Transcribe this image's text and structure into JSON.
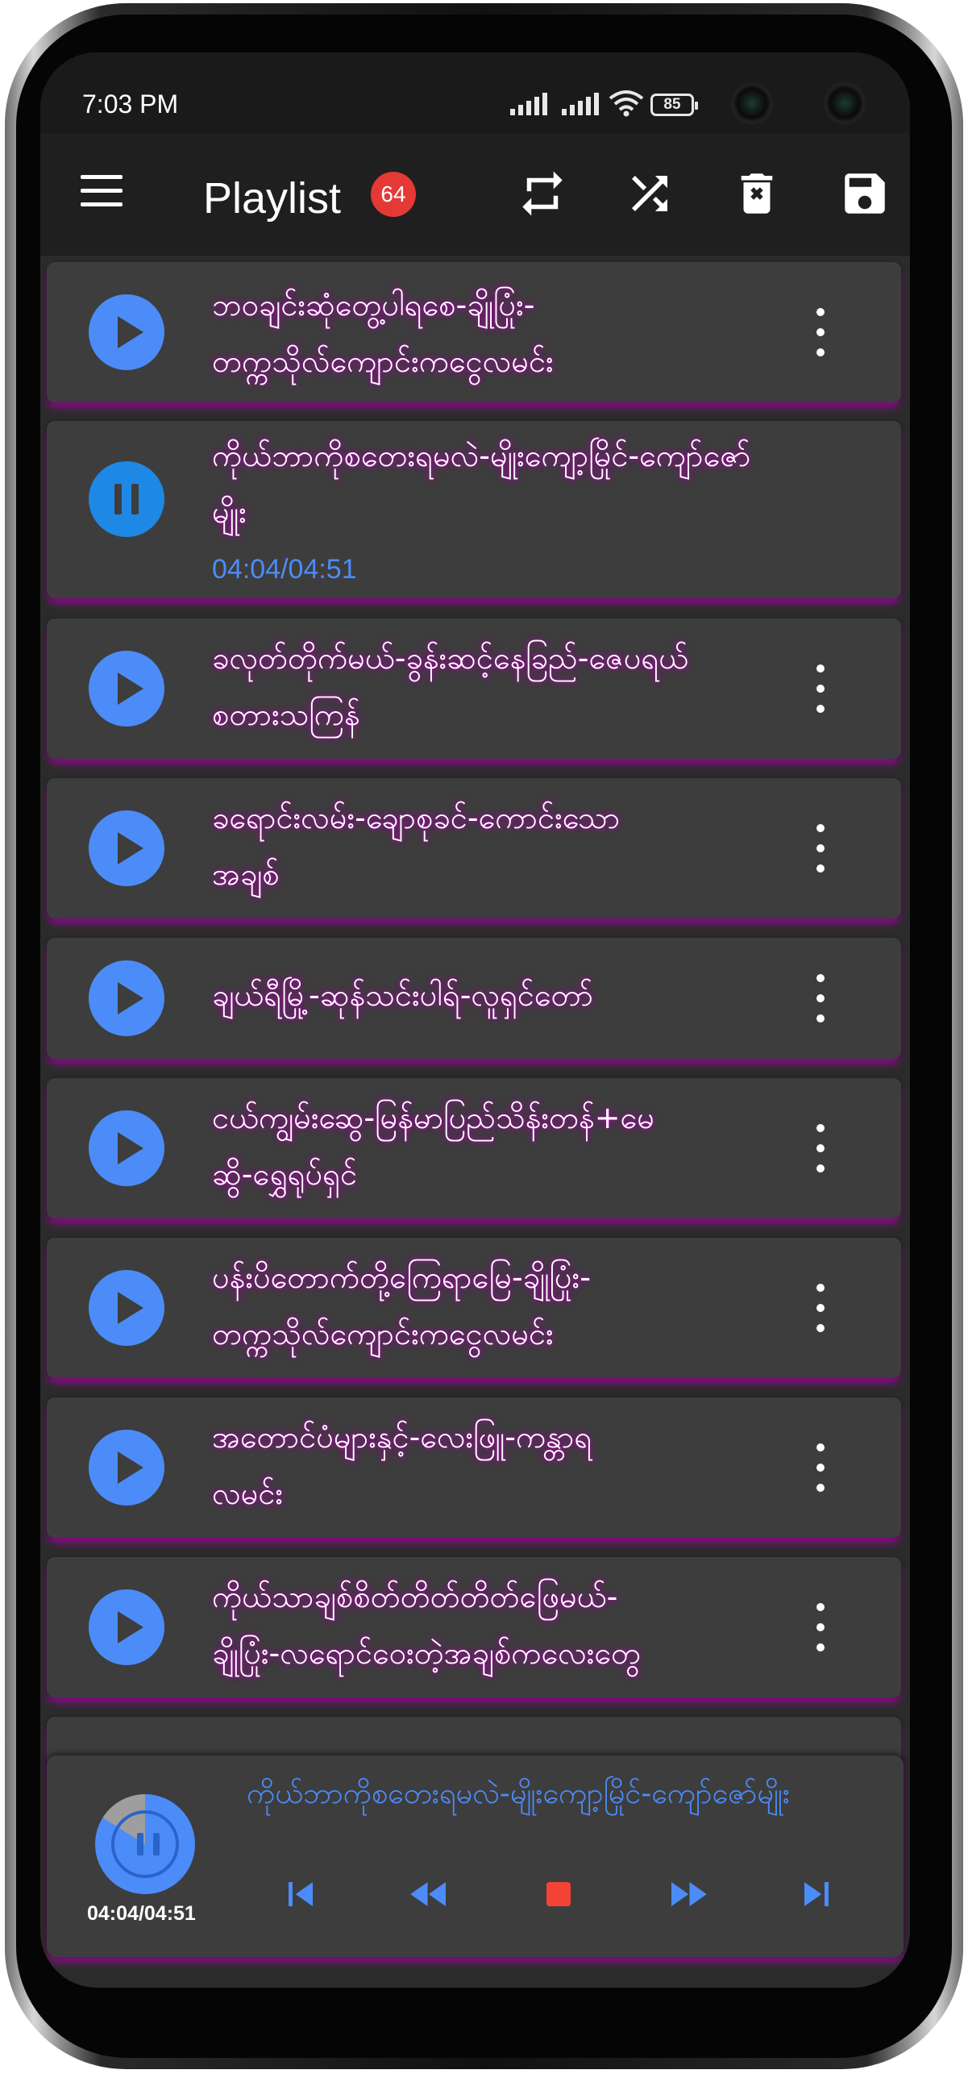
{
  "status_bar": {
    "time": "7:03 PM",
    "battery_level": "85"
  },
  "app_bar": {
    "title": "Playlist",
    "count_badge": "64",
    "icons": [
      "menu-icon",
      "repeat-icon",
      "shuffle-icon",
      "delete-icon",
      "save-icon"
    ]
  },
  "playlist": {
    "items": [
      {
        "line1": "ဘဝချင်းဆုံတွေ့ပါရစေ-ချိုပြုံး-",
        "line2": "တက္ကသိုလ်ကျောင်းကငွေလမင်း",
        "state": "play"
      },
      {
        "line1": "ကိုယ်ဘာကိုစတေးရမလဲ-မျိုးကျော့မြိုင်-ကျော်ဇော်",
        "line2": "မျိုး",
        "state": "pause",
        "progress": "04:04/04:51"
      },
      {
        "line1": "ခလုတ်တိုက်မယ်-ခွန်းဆင့်နေခြည်-ဇေပရယ်",
        "line2": "စတားသကြန်",
        "state": "play"
      },
      {
        "line1": "ခရောင်းလမ်း-ချောစုခင်-ကောင်းသော",
        "line2": "အချစ်",
        "state": "play"
      },
      {
        "line1": "ချယ်ရီမြို့-ဆုန်သင်းပါရ်-လူရှင်တော်",
        "line2": "",
        "state": "play"
      },
      {
        "line1": "ငယ်ကျွမ်းဆွေ-မြန်မာပြည်သိန်းတန်+မေ",
        "line2": "ဆွိ-ရွှေရုပ်ရှင်",
        "state": "play"
      },
      {
        "line1": "ပန်းပိတောက်တို့ကြေရာမြေ-ချိုပြုံး-",
        "line2": "တက္ကသိုလ်ကျောင်းကငွေလမင်း",
        "state": "play"
      },
      {
        "line1": "အတောင်ပံများနှင့်-လေးဖြူ-ကန္တာရ",
        "line2": "လမင်း",
        "state": "play"
      },
      {
        "line1": "ကိုယ်သာချစ်စိတ်တိတ်တိတ်ဖြေမယ်-",
        "line2": "ချိုပြုံး-လရောင်ဝေးတဲ့အချစ်ကလေးတွေ",
        "state": "play"
      }
    ]
  },
  "now_playing": {
    "title": "ကိုယ်ဘာကိုစတေးရမလဲ-မျိုးကျော့မြိုင်-ကျော်ဇော်မျိုး",
    "time": "04:04/04:51",
    "progress": 0.838,
    "controls": [
      "skip-previous-icon",
      "rewind-icon",
      "stop-icon",
      "fast-forward-icon",
      "skip-next-icon"
    ],
    "accent_color": "#4c8cf8",
    "stop_color": "#f44336"
  }
}
